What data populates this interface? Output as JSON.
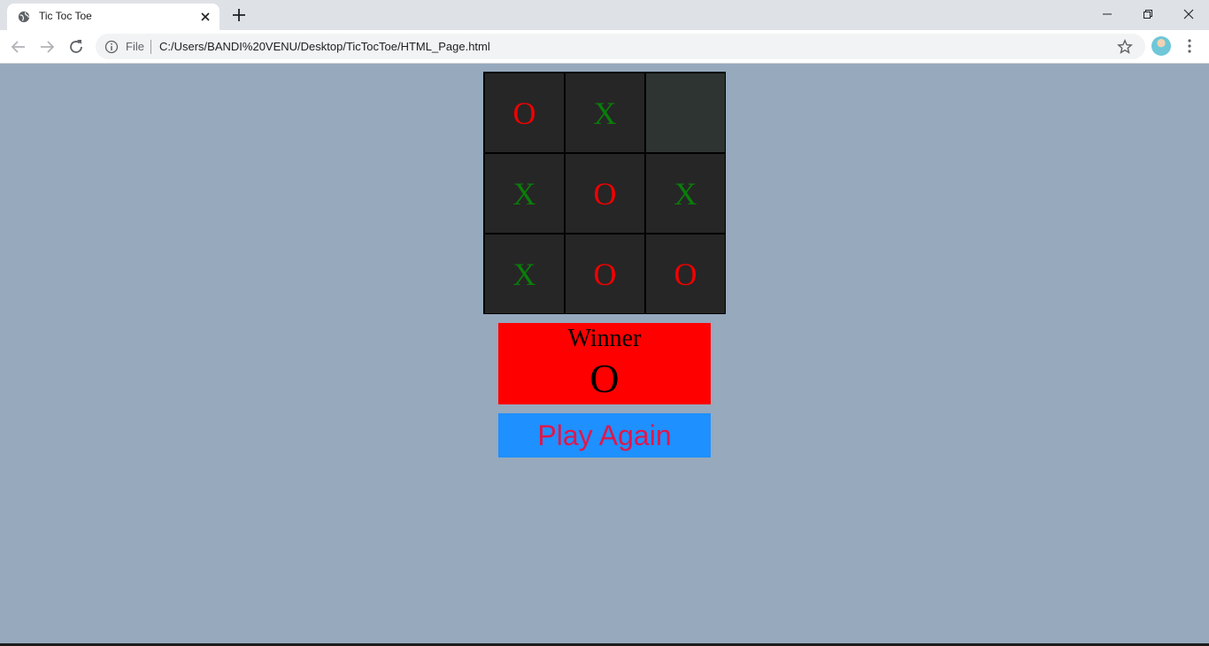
{
  "browser": {
    "tab_title": "Tic Toc Toe",
    "omnibox_scheme": "File",
    "url": "C:/Users/BANDI%20VENU/Desktop/TicTocToe/HTML_Page.html"
  },
  "board": {
    "cells": [
      "O",
      "X",
      "",
      "X",
      "O",
      "X",
      "X",
      "O",
      "O"
    ]
  },
  "winner": {
    "label": "Winner",
    "value": "O"
  },
  "play_again_label": "Play Again",
  "colors": {
    "page_bg": "#96a9bd",
    "cell_bg": "#262626",
    "x_mark": "#0a7d0a",
    "o_mark": "#f00000",
    "winner_bg": "#ff0000",
    "button_bg": "#1e90ff",
    "button_text": "#e0174c"
  },
  "icons": {
    "tab_favicon": "globe-icon",
    "tab_close": "close-icon",
    "new_tab": "plus-icon",
    "back": "arrow-left-icon",
    "forward": "arrow-right-icon",
    "reload": "reload-icon",
    "site_info": "info-icon",
    "bookmark": "star-icon",
    "menu": "kebab-menu-icon"
  }
}
